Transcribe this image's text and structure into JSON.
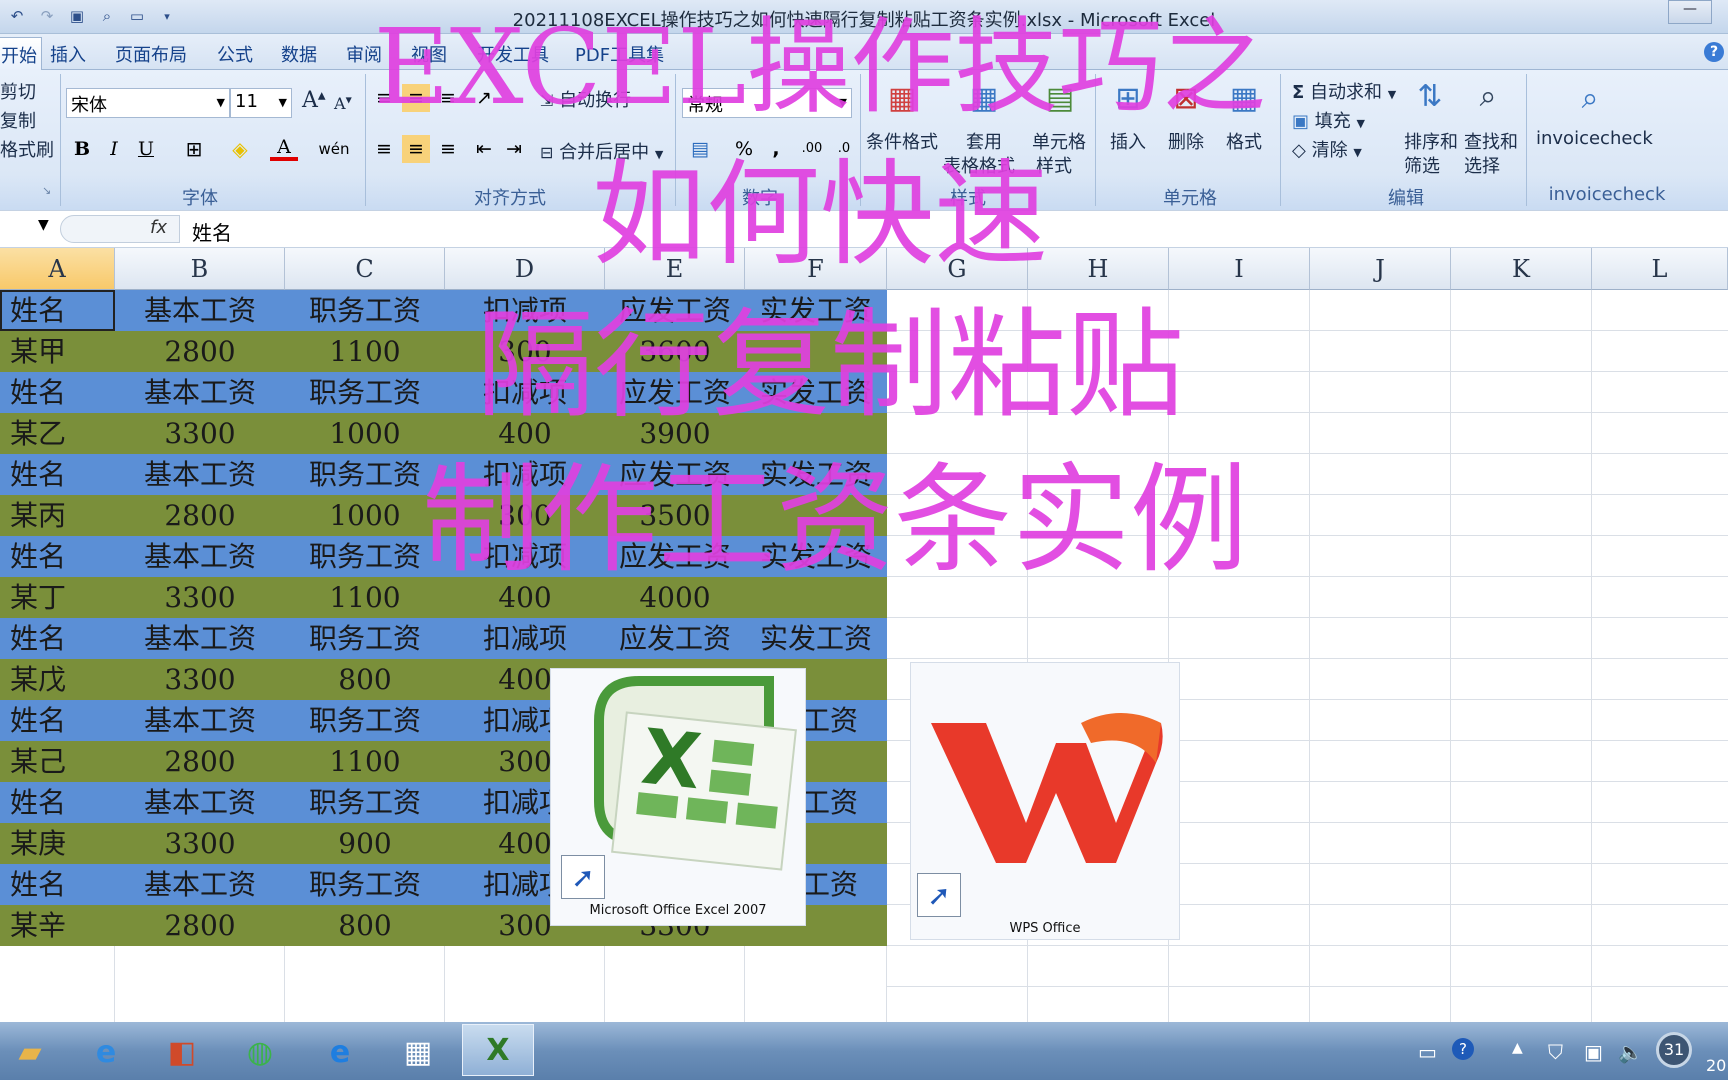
{
  "window": {
    "title": "20211108EXCEL操作技巧之如何快速隔行复制粘贴工资条实例.xlsx - Microsoft Excel"
  },
  "qat": [
    "undo-icon",
    "redo-icon",
    "camera-icon",
    "print-preview-icon",
    "new-file-icon",
    "customize-icon"
  ],
  "tabs": [
    {
      "label": "开始",
      "active": true
    },
    {
      "label": "插入"
    },
    {
      "label": "页面布局"
    },
    {
      "label": "公式"
    },
    {
      "label": "数据"
    },
    {
      "label": "审阅"
    },
    {
      "label": "视图"
    },
    {
      "label": "开发工具"
    },
    {
      "label": "PDF工具集"
    }
  ],
  "ribbon": {
    "clipboard": {
      "cut": "剪切",
      "copy": "复制",
      "painter": "格式刷"
    },
    "font": {
      "name": "宋体",
      "size": "11",
      "label": "字体"
    },
    "alignment": {
      "wrap": "自动换行",
      "merge": "合并后居中",
      "label": "对齐方式"
    },
    "number": {
      "format": "常规",
      "label": "数字"
    },
    "styles": {
      "conditional": "条件格式",
      "table_l1": "套用",
      "table_l2": "表格格式",
      "cell_l1": "单元格",
      "cell_l2": "样式",
      "label": "样式"
    },
    "cells": {
      "insert": "插入",
      "delete": "删除",
      "format": "格式",
      "label": "单元格"
    },
    "editing": {
      "autosum": "自动求和",
      "fill": "填充",
      "clear": "清除",
      "sort_l1": "排序和",
      "sort_l2": "筛选",
      "find_l1": "查找和",
      "find_l2": "选择",
      "label": "编辑"
    },
    "invoice": {
      "button": "invoicecheck",
      "label": "invoicecheck"
    }
  },
  "formula_bar": {
    "fx": "fx",
    "content": "姓名"
  },
  "columns": [
    "A",
    "B",
    "C",
    "D",
    "E",
    "F",
    "G",
    "H",
    "I",
    "J",
    "K",
    "L"
  ],
  "sheet_rows": [
    [
      "姓名",
      "基本工资",
      "职务工资",
      "扣减项",
      "应发工资",
      "实发工资"
    ],
    [
      "某甲",
      "2800",
      "1100",
      "300",
      "3600",
      ""
    ],
    [
      "姓名",
      "基本工资",
      "职务工资",
      "扣减项",
      "应发工资",
      "实发工资"
    ],
    [
      "某乙",
      "3300",
      "1000",
      "400",
      "3900",
      ""
    ],
    [
      "姓名",
      "基本工资",
      "职务工资",
      "扣减项",
      "应发工资",
      "实发工资"
    ],
    [
      "某丙",
      "2800",
      "1000",
      "300",
      "3500",
      ""
    ],
    [
      "姓名",
      "基本工资",
      "职务工资",
      "扣减项",
      "应发工资",
      "实发工资"
    ],
    [
      "某丁",
      "3300",
      "1100",
      "400",
      "4000",
      ""
    ],
    [
      "姓名",
      "基本工资",
      "职务工资",
      "扣减项",
      "应发工资",
      "实发工资"
    ],
    [
      "某戊",
      "3300",
      "800",
      "400",
      "",
      ""
    ],
    [
      "姓名",
      "基本工资",
      "职务工资",
      "扣减项",
      "",
      "发工资"
    ],
    [
      "某己",
      "2800",
      "1100",
      "300",
      "",
      ""
    ],
    [
      "姓名",
      "基本工资",
      "职务工资",
      "扣减项",
      "",
      "发工资"
    ],
    [
      "某庚",
      "3300",
      "900",
      "400",
      "",
      ""
    ],
    [
      "姓名",
      "基本工资",
      "职务工资",
      "扣减项",
      "",
      "发工资"
    ],
    [
      "某辛",
      "2800",
      "800",
      "300",
      "3300",
      ""
    ]
  ],
  "overlay_text": [
    "EXCEL操作技巧之",
    "如何快速",
    "隔行复制粘贴",
    "制作工资条实例"
  ],
  "shortcuts": [
    {
      "label": "Microsoft Office Excel 2007",
      "icon": "excel-2007-icon"
    },
    {
      "label": "WPS Office",
      "icon": "wps-office-icon"
    }
  ],
  "taskbar": {
    "clock_partial": "20",
    "badge": "31"
  }
}
